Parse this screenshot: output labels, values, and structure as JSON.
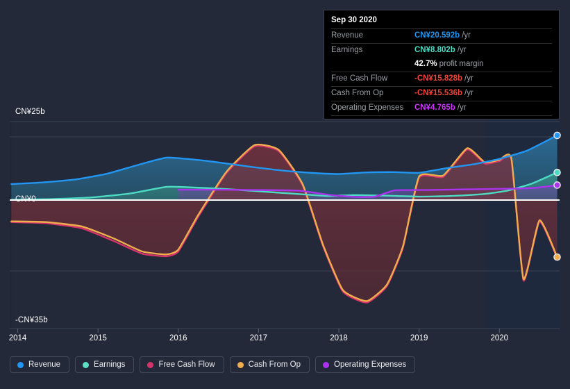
{
  "tooltip": {
    "title": "Sep 30 2020",
    "rows": [
      {
        "label": "Revenue",
        "value": "CN¥20.592b",
        "unit": "/yr",
        "color": "#2196f3"
      },
      {
        "label": "Earnings",
        "value": "CN¥8.802b",
        "unit": "/yr",
        "color": "#4ddbc4"
      },
      {
        "label": "",
        "value": "42.7%",
        "unit": "profit margin",
        "color": "#ffffff"
      },
      {
        "label": "Free Cash Flow",
        "value": "-CN¥15.828b",
        "unit": "/yr",
        "color": "#f4433a"
      },
      {
        "label": "Cash From Op",
        "value": "-CN¥15.536b",
        "unit": "/yr",
        "color": "#f4433a"
      },
      {
        "label": "Operating Expenses",
        "value": "CN¥4.765b",
        "unit": "/yr",
        "color": "#cc33ff"
      }
    ]
  },
  "legend": {
    "items": [
      {
        "label": "Revenue",
        "color": "#2196f3"
      },
      {
        "label": "Earnings",
        "color": "#5ce0c4"
      },
      {
        "label": "Free Cash Flow",
        "color": "#d6336c"
      },
      {
        "label": "Cash From Op",
        "color": "#f0ad4e"
      },
      {
        "label": "Operating Expenses",
        "color": "#aa33ee"
      }
    ]
  },
  "chart_data": {
    "type": "area",
    "title": "",
    "xlabel": "",
    "ylabel": "",
    "currency": "CN¥",
    "unit": "b",
    "ylim": [
      -35,
      25
    ],
    "y_ticks": [
      25,
      0,
      -35
    ],
    "y_tick_labels": [
      "CN¥25b",
      "CN¥0",
      "-CN¥35b"
    ],
    "grid": true,
    "legend_position": "bottom",
    "x_ticks": [
      2014,
      2015,
      2016,
      2017,
      2018,
      2019,
      2020
    ],
    "x_tick_labels": [
      "2014",
      "2015",
      "2016",
      "2017",
      "2018",
      "2019",
      "2020"
    ],
    "xlim": [
      2013.9,
      2020.75
    ],
    "forecast_start": 2019.83,
    "highlight_date": "Sep 30 2020",
    "series": [
      {
        "name": "Revenue",
        "color": "#2196f3",
        "fill": "#1d4f6e",
        "x": [
          2013.92,
          2014.3,
          2014.7,
          2015.1,
          2015.5,
          2015.85,
          2016.15,
          2016.5,
          2016.9,
          2017.3,
          2017.7,
          2018.0,
          2018.35,
          2018.7,
          2019.0,
          2019.35,
          2019.7,
          2020.0,
          2020.35,
          2020.72
        ],
        "y": [
          5.1,
          5.6,
          6.5,
          8.3,
          11.2,
          13.5,
          13.0,
          12.0,
          10.6,
          9.4,
          8.6,
          8.3,
          8.8,
          8.9,
          8.7,
          10.2,
          11.5,
          13.1,
          15.8,
          20.592
        ]
      },
      {
        "name": "Earnings",
        "color": "#4ddbc4",
        "fill": "#2a6d66",
        "x": [
          2013.92,
          2014.4,
          2014.9,
          2015.4,
          2015.85,
          2016.2,
          2016.6,
          2017.0,
          2017.45,
          2017.85,
          2018.2,
          2018.6,
          2019.0,
          2019.4,
          2019.8,
          2020.1,
          2020.4,
          2020.72
        ],
        "y": [
          0.1,
          0.3,
          0.8,
          2.1,
          4.2,
          4.0,
          3.5,
          2.8,
          2.0,
          1.3,
          1.6,
          1.4,
          1.1,
          1.3,
          1.9,
          3.0,
          5.2,
          8.802
        ]
      },
      {
        "name": "Operating Expenses",
        "color": "#aa33ee",
        "fill": "#5a4687",
        "x": [
          2016.0,
          2016.5,
          2017.0,
          2017.5,
          2017.9,
          2018.2,
          2018.45,
          2018.7,
          2019.1,
          2019.6,
          2020.1,
          2020.45,
          2020.72
        ],
        "y": [
          3.3,
          3.3,
          3.2,
          3.0,
          1.6,
          1.0,
          1.1,
          3.1,
          3.2,
          3.4,
          3.6,
          3.9,
          4.765
        ]
      },
      {
        "name": "Cash From Op",
        "color": "#f0ad4e",
        "fill": "#6b2f38",
        "x": [
          2013.92,
          2014.35,
          2014.8,
          2015.2,
          2015.55,
          2015.85,
          2016.0,
          2016.25,
          2016.6,
          2016.95,
          2017.25,
          2017.55,
          2017.8,
          2018.05,
          2018.35,
          2018.6,
          2018.8,
          2019.0,
          2019.3,
          2019.6,
          2019.82,
          2020.0,
          2020.15,
          2020.3,
          2020.5,
          2020.72
        ],
        "y": [
          -5.8,
          -6.0,
          -7.2,
          -10.5,
          -14.0,
          -14.8,
          -13.5,
          -4.0,
          9.0,
          17.5,
          16.0,
          5.0,
          -12.0,
          -24.5,
          -27.5,
          -23.0,
          -12.5,
          7.5,
          7.8,
          16.5,
          12.0,
          12.8,
          13.2,
          -21.5,
          -5.5,
          -15.536
        ]
      },
      {
        "name": "Free Cash Flow",
        "color": "#d6336c",
        "fill": "#6b2f38",
        "x": [
          2013.92,
          2014.35,
          2014.8,
          2015.2,
          2015.55,
          2015.85,
          2016.0,
          2016.25,
          2016.6,
          2016.95,
          2017.25,
          2017.55,
          2017.8,
          2018.05,
          2018.35,
          2018.6,
          2018.8,
          2019.0,
          2019.3,
          2019.6,
          2019.82,
          2020.0,
          2020.15,
          2020.3,
          2020.5,
          2020.72
        ],
        "y": [
          -6.0,
          -6.3,
          -7.7,
          -11.2,
          -14.6,
          -15.3,
          -14.0,
          -4.5,
          8.6,
          17.1,
          15.6,
          4.6,
          -12.4,
          -24.9,
          -27.9,
          -23.4,
          -12.9,
          7.1,
          7.4,
          16.1,
          11.6,
          12.4,
          12.8,
          -21.9,
          -5.9,
          -15.828
        ]
      }
    ],
    "endpoints": [
      {
        "name": "Revenue",
        "value": 20.592,
        "color": "#2196f3"
      },
      {
        "name": "Earnings",
        "value": 8.802,
        "color": "#4ddbc4"
      },
      {
        "name": "Operating Expenses",
        "value": 4.765,
        "color": "#aa33ee"
      },
      {
        "name": "Cash From Op",
        "value": -15.536,
        "color": "#f0ad4e"
      }
    ]
  }
}
